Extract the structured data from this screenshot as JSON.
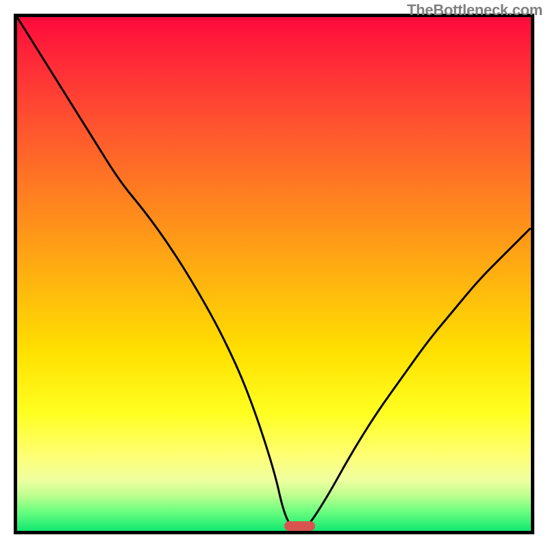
{
  "watermark": "TheBottleneck.com",
  "chart_data": {
    "type": "line",
    "title": "",
    "xlabel": "",
    "ylabel": "",
    "xlim": [
      0,
      100
    ],
    "ylim": [
      0,
      100
    ],
    "x": [
      0,
      5,
      10,
      15,
      20,
      25,
      30,
      35,
      40,
      45,
      50,
      52,
      54,
      56,
      60,
      65,
      70,
      75,
      80,
      85,
      90,
      95,
      100
    ],
    "values": [
      100,
      92,
      84,
      76,
      68,
      62,
      55,
      47,
      38,
      27,
      12,
      3,
      0,
      0,
      6,
      15,
      23,
      30,
      37,
      43,
      49,
      54,
      59
    ],
    "gradient_stops": [
      {
        "pos": 0,
        "color": "#ff0a3c"
      },
      {
        "pos": 20,
        "color": "#ff5030"
      },
      {
        "pos": 50,
        "color": "#ffb010"
      },
      {
        "pos": 77,
        "color": "#ffff20"
      },
      {
        "pos": 93,
        "color": "#c0ff90"
      },
      {
        "pos": 100,
        "color": "#10e870"
      }
    ],
    "marker": {
      "x_start": 52,
      "x_end": 58,
      "y": 0,
      "color": "#d9534f"
    },
    "curve_color": "#000000",
    "curve_width": 3
  }
}
